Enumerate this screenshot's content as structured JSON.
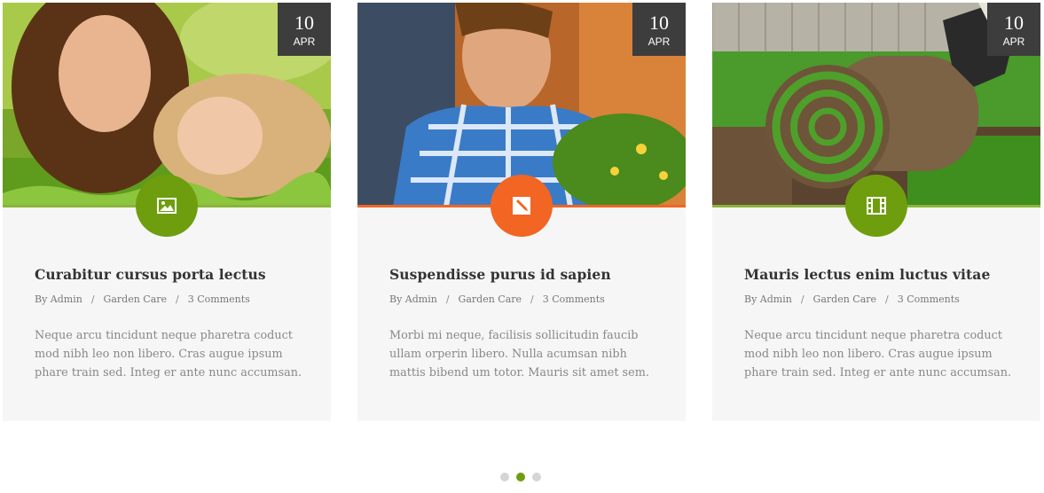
{
  "posts": [
    {
      "date": {
        "day": "10",
        "month": "APR"
      },
      "format_icon": "image-icon",
      "title": "Curabitur cursus porta lectus",
      "meta": {
        "author": "By Admin",
        "category": "Garden Care",
        "comments": "3 Comments"
      },
      "excerpt": "Neque arcu tincidunt neque pharetra coduct mod nibh leo non libero. Cras augue ipsum phare train sed.  Integ er ante nunc accumsan."
    },
    {
      "date": {
        "day": "10",
        "month": "APR"
      },
      "format_icon": "pencil-icon",
      "title": "Suspendisse purus id sapien",
      "meta": {
        "author": "By Admin",
        "category": "Garden Care",
        "comments": "3 Comments"
      },
      "excerpt": "Morbi mi neque, facilisis sollicitudin faucib ullam orperin libero. Nulla acumsan nibh mattis bibend um totor. Mauris sit amet sem."
    },
    {
      "date": {
        "day": "10",
        "month": "APR"
      },
      "format_icon": "film-icon",
      "title": "Mauris lectus enim luctus vitae",
      "meta": {
        "author": "By Admin",
        "category": "Garden Care",
        "comments": "3 Comments"
      },
      "excerpt": "Neque arcu tincidunt neque pharetra coduct mod nibh leo non libero. Cras augue ipsum phare train sed.  Integ er ante nunc accumsan."
    }
  ],
  "meta_separator": "/",
  "colors": {
    "green": "#6e9e0e",
    "orange": "#f26522",
    "badge": "#3d3d3d"
  },
  "pagination": {
    "total": 3,
    "active": 2
  }
}
